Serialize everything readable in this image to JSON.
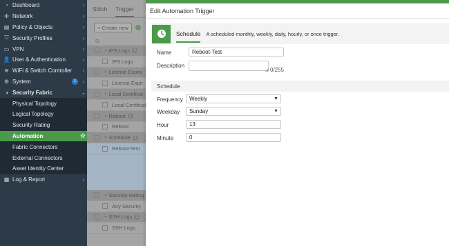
{
  "sidebar": {
    "items": [
      {
        "label": "Dashboard",
        "icon": "dashboard-icon",
        "glyph": "◔"
      },
      {
        "label": "Network",
        "icon": "network-icon",
        "glyph": "✣"
      },
      {
        "label": "Policy & Objects",
        "icon": "policy-icon",
        "glyph": "▤"
      },
      {
        "label": "Security Profiles",
        "icon": "shield-icon",
        "glyph": "⛉"
      },
      {
        "label": "VPN",
        "icon": "vpn-icon",
        "glyph": "▭"
      },
      {
        "label": "User & Authentication",
        "icon": "user-icon",
        "glyph": "👤"
      },
      {
        "label": "WiFi & Switch Controller",
        "icon": "wifi-icon",
        "glyph": "≋"
      },
      {
        "label": "System",
        "icon": "gear-icon",
        "glyph": "⚙",
        "badge": "1"
      },
      {
        "label": "Security Fabric",
        "icon": "fabric-icon",
        "glyph": "◑"
      }
    ],
    "fabric_sub": [
      {
        "label": "Physical Topology"
      },
      {
        "label": "Logical Topology"
      },
      {
        "label": "Security Rating"
      },
      {
        "label": "Automation"
      },
      {
        "label": "Fabric Connectors"
      },
      {
        "label": "External Connectors"
      },
      {
        "label": "Asset Identity Center"
      }
    ],
    "log_report": {
      "label": "Log & Report",
      "glyph": "▦"
    }
  },
  "middle": {
    "tabs": [
      "Stitch",
      "Trigger"
    ],
    "create_new": "+ Create new",
    "rows_top": [
      {
        "label": "IPS Logs",
        "type": "group",
        "count": "1"
      },
      {
        "label": "IPS Logs",
        "type": "child"
      },
      {
        "label": "License Expiry",
        "type": "group"
      },
      {
        "label": "License Expir",
        "type": "child"
      },
      {
        "label": "Local Certificat",
        "type": "group"
      },
      {
        "label": "Local Certificat",
        "type": "child"
      },
      {
        "label": "Reboot",
        "type": "group",
        "count": "1"
      },
      {
        "label": "Reboot",
        "type": "child"
      },
      {
        "label": "Schedule",
        "type": "group",
        "count": "1"
      },
      {
        "label": "Reboot-Test",
        "type": "child"
      }
    ],
    "rows_bottom": [
      {
        "label": "Security Rating",
        "type": "group"
      },
      {
        "label": "Any Security",
        "type": "child"
      },
      {
        "label": "SSH Logs",
        "type": "group",
        "count": "1"
      },
      {
        "label": "SSH Logs",
        "type": "child"
      }
    ]
  },
  "dialog": {
    "title": "Edit Automation Trigger",
    "trigger": {
      "name": "Schedule",
      "description": "A scheduled monthly, weekly, daily, hourly, or once trigger."
    },
    "name_label": "Name",
    "name_value": "Reboot-Test",
    "description_label": "Description",
    "description_value": "",
    "description_count": "0/255",
    "schedule_section": "Schedule",
    "frequency_label": "Frequency",
    "frequency_value": "Weekly",
    "weekday_label": "Weekday",
    "weekday_value": "Sunday",
    "hour_label": "Hour",
    "hour_value": "13",
    "minute_label": "Minute",
    "minute_value": "0"
  },
  "colors": {
    "accent": "#4a9a4a",
    "sidebar_bg": "#2d3b48",
    "badge_blue": "#2f79c4"
  }
}
